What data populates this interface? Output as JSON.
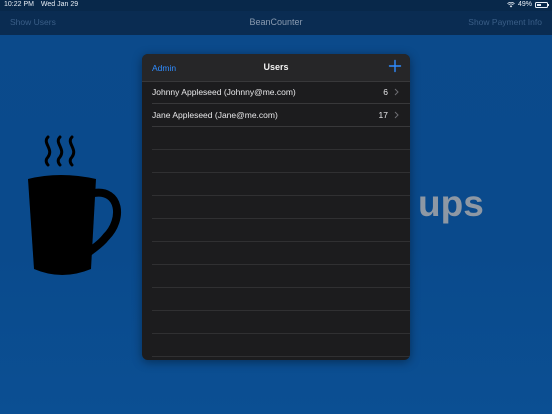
{
  "status_bar": {
    "time": "10:22 PM",
    "date": "Wed Jan 29",
    "battery": "49%",
    "battery_level": 0.49
  },
  "navbar": {
    "left_button": "Show Users",
    "title": "BeanCounter",
    "right_button": "Show Payment Info"
  },
  "background": {
    "partial_text": "ups"
  },
  "popover": {
    "admin_label": "Admin",
    "title": "Users",
    "add_icon": "plus-icon",
    "users": [
      {
        "name": "Johnny Appleseed (Johnny@me.com)",
        "count": "6"
      },
      {
        "name": "Jane Appleseed (Jane@me.com)",
        "count": "17"
      }
    ]
  },
  "colors": {
    "accent": "#2f8cff",
    "background_blue": "#0a4a8a",
    "popover_bg": "#1c1c1e"
  }
}
